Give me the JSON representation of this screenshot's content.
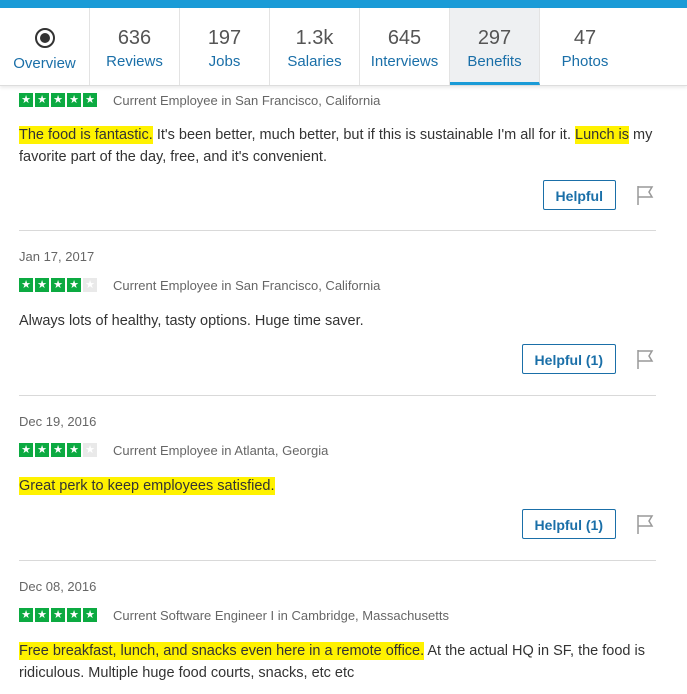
{
  "tabs": [
    {
      "count": "",
      "label": "Overview",
      "icon": "overview-circle-icon"
    },
    {
      "count": "636",
      "label": "Reviews"
    },
    {
      "count": "197",
      "label": "Jobs"
    },
    {
      "count": "1.3k",
      "label": "Salaries"
    },
    {
      "count": "645",
      "label": "Interviews"
    },
    {
      "count": "297",
      "label": "Benefits"
    },
    {
      "count": "47",
      "label": "Photos"
    }
  ],
  "colors": {
    "accent": "#1a9bd7",
    "star": "#0caa41",
    "highlight": "#fff200",
    "link": "#1a6fa8"
  },
  "reviews": [
    {
      "date": "",
      "rating": 5,
      "employee": "Current Employee in San Francisco, California",
      "text": {
        "h1": "The food is fantastic.",
        "p1": " It's been better, much better, but if this is sustainable I'm all for it. ",
        "h2": "Lunch is",
        "p2": " my favorite part of the day, free, and it's convenient."
      },
      "helpful": "Helpful"
    },
    {
      "date": "Jan 17, 2017",
      "rating": 4,
      "employee": "Current Employee in San Francisco, California",
      "text": {
        "p1": "Always lots of healthy, tasty options. Huge time saver."
      },
      "helpful": "Helpful (1)"
    },
    {
      "date": "Dec 19, 2016",
      "rating": 4,
      "employee": "Current Employee in Atlanta, Georgia",
      "text": {
        "h1": "Great perk to keep employees satisfied."
      },
      "helpful": "Helpful (1)"
    },
    {
      "date": "Dec 08, 2016",
      "rating": 5,
      "employee": "Current Software Engineer I in Cambridge, Massachusetts",
      "text": {
        "h1": "Free breakfast, lunch, and snacks even here in a remote office.",
        "p1": " At the actual HQ in SF, the food is ridiculous. Multiple huge food courts, snacks, etc etc"
      },
      "helpful": ""
    }
  ]
}
